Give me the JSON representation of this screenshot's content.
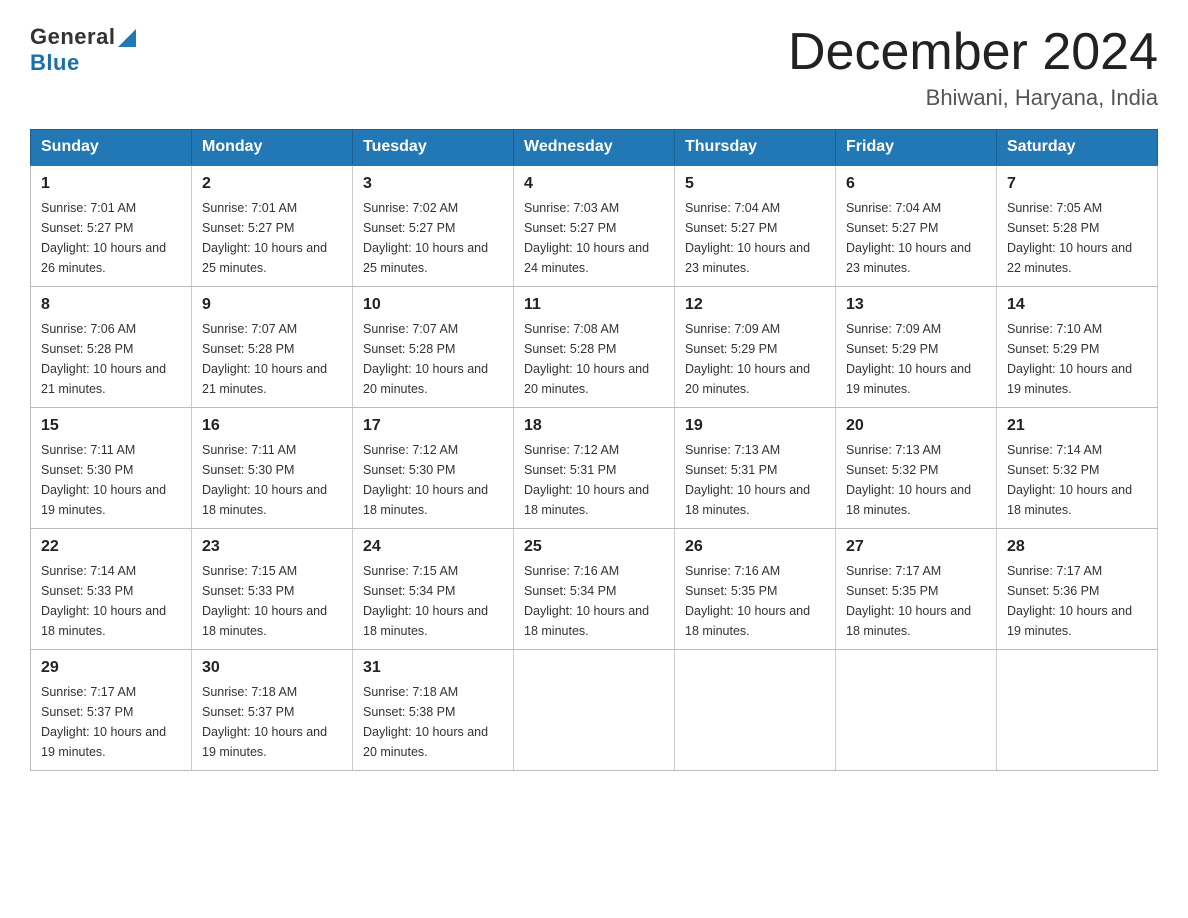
{
  "header": {
    "logo_general": "General",
    "logo_blue": "Blue",
    "month_title": "December 2024",
    "location": "Bhiwani, Haryana, India"
  },
  "days_of_week": [
    "Sunday",
    "Monday",
    "Tuesday",
    "Wednesday",
    "Thursday",
    "Friday",
    "Saturday"
  ],
  "weeks": [
    [
      {
        "day": "1",
        "sunrise": "7:01 AM",
        "sunset": "5:27 PM",
        "daylight": "10 hours and 26 minutes."
      },
      {
        "day": "2",
        "sunrise": "7:01 AM",
        "sunset": "5:27 PM",
        "daylight": "10 hours and 25 minutes."
      },
      {
        "day": "3",
        "sunrise": "7:02 AM",
        "sunset": "5:27 PM",
        "daylight": "10 hours and 25 minutes."
      },
      {
        "day": "4",
        "sunrise": "7:03 AM",
        "sunset": "5:27 PM",
        "daylight": "10 hours and 24 minutes."
      },
      {
        "day": "5",
        "sunrise": "7:04 AM",
        "sunset": "5:27 PM",
        "daylight": "10 hours and 23 minutes."
      },
      {
        "day": "6",
        "sunrise": "7:04 AM",
        "sunset": "5:27 PM",
        "daylight": "10 hours and 23 minutes."
      },
      {
        "day": "7",
        "sunrise": "7:05 AM",
        "sunset": "5:28 PM",
        "daylight": "10 hours and 22 minutes."
      }
    ],
    [
      {
        "day": "8",
        "sunrise": "7:06 AM",
        "sunset": "5:28 PM",
        "daylight": "10 hours and 21 minutes."
      },
      {
        "day": "9",
        "sunrise": "7:07 AM",
        "sunset": "5:28 PM",
        "daylight": "10 hours and 21 minutes."
      },
      {
        "day": "10",
        "sunrise": "7:07 AM",
        "sunset": "5:28 PM",
        "daylight": "10 hours and 20 minutes."
      },
      {
        "day": "11",
        "sunrise": "7:08 AM",
        "sunset": "5:28 PM",
        "daylight": "10 hours and 20 minutes."
      },
      {
        "day": "12",
        "sunrise": "7:09 AM",
        "sunset": "5:29 PM",
        "daylight": "10 hours and 20 minutes."
      },
      {
        "day": "13",
        "sunrise": "7:09 AM",
        "sunset": "5:29 PM",
        "daylight": "10 hours and 19 minutes."
      },
      {
        "day": "14",
        "sunrise": "7:10 AM",
        "sunset": "5:29 PM",
        "daylight": "10 hours and 19 minutes."
      }
    ],
    [
      {
        "day": "15",
        "sunrise": "7:11 AM",
        "sunset": "5:30 PM",
        "daylight": "10 hours and 19 minutes."
      },
      {
        "day": "16",
        "sunrise": "7:11 AM",
        "sunset": "5:30 PM",
        "daylight": "10 hours and 18 minutes."
      },
      {
        "day": "17",
        "sunrise": "7:12 AM",
        "sunset": "5:30 PM",
        "daylight": "10 hours and 18 minutes."
      },
      {
        "day": "18",
        "sunrise": "7:12 AM",
        "sunset": "5:31 PM",
        "daylight": "10 hours and 18 minutes."
      },
      {
        "day": "19",
        "sunrise": "7:13 AM",
        "sunset": "5:31 PM",
        "daylight": "10 hours and 18 minutes."
      },
      {
        "day": "20",
        "sunrise": "7:13 AM",
        "sunset": "5:32 PM",
        "daylight": "10 hours and 18 minutes."
      },
      {
        "day": "21",
        "sunrise": "7:14 AM",
        "sunset": "5:32 PM",
        "daylight": "10 hours and 18 minutes."
      }
    ],
    [
      {
        "day": "22",
        "sunrise": "7:14 AM",
        "sunset": "5:33 PM",
        "daylight": "10 hours and 18 minutes."
      },
      {
        "day": "23",
        "sunrise": "7:15 AM",
        "sunset": "5:33 PM",
        "daylight": "10 hours and 18 minutes."
      },
      {
        "day": "24",
        "sunrise": "7:15 AM",
        "sunset": "5:34 PM",
        "daylight": "10 hours and 18 minutes."
      },
      {
        "day": "25",
        "sunrise": "7:16 AM",
        "sunset": "5:34 PM",
        "daylight": "10 hours and 18 minutes."
      },
      {
        "day": "26",
        "sunrise": "7:16 AM",
        "sunset": "5:35 PM",
        "daylight": "10 hours and 18 minutes."
      },
      {
        "day": "27",
        "sunrise": "7:17 AM",
        "sunset": "5:35 PM",
        "daylight": "10 hours and 18 minutes."
      },
      {
        "day": "28",
        "sunrise": "7:17 AM",
        "sunset": "5:36 PM",
        "daylight": "10 hours and 19 minutes."
      }
    ],
    [
      {
        "day": "29",
        "sunrise": "7:17 AM",
        "sunset": "5:37 PM",
        "daylight": "10 hours and 19 minutes."
      },
      {
        "day": "30",
        "sunrise": "7:18 AM",
        "sunset": "5:37 PM",
        "daylight": "10 hours and 19 minutes."
      },
      {
        "day": "31",
        "sunrise": "7:18 AM",
        "sunset": "5:38 PM",
        "daylight": "10 hours and 20 minutes."
      },
      null,
      null,
      null,
      null
    ]
  ],
  "labels": {
    "sunrise_prefix": "Sunrise: ",
    "sunset_prefix": "Sunset: ",
    "daylight_prefix": "Daylight: "
  }
}
